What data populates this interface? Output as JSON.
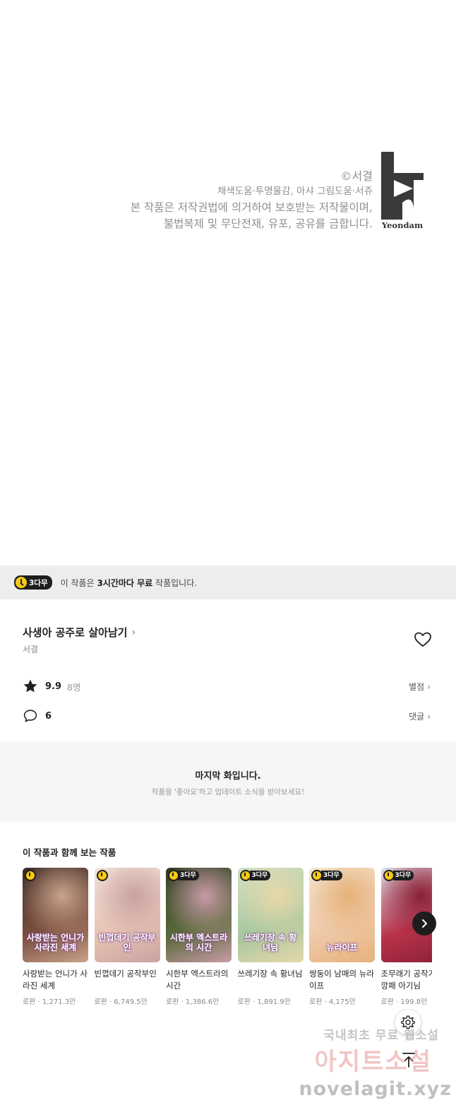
{
  "copyright": {
    "line1": "©서결",
    "line2": "채색도움·투명물감, 아샤 그림도움·서쥬",
    "line3": "본 작품은 저작권법에 의거하여 보호받는 저작물이며,",
    "line4": "불법복제 및 무단전재, 유포, 공유를 금합니다.",
    "logo_text": "Yeondam"
  },
  "free_banner": {
    "badge": "3다무",
    "text_pre": "이 작품은 ",
    "text_bold": "3시간마다 무료",
    "text_post": " 작품입니다."
  },
  "work": {
    "title": "사생아 공주로 살아남기",
    "title_chevron": "›",
    "author": "서결",
    "rating": "9.9",
    "rating_count": "8명",
    "comment_count": "6",
    "rate_link": "별점",
    "comment_link": "댓글",
    "link_chevron": "›"
  },
  "last_episode": {
    "title": "마지막 화입니다.",
    "subtitle": "작품을 '좋아요'하고 업데이트 소식을 받아보세요!"
  },
  "recommendations": {
    "heading": "이 작품과 함께 보는 작품",
    "items": [
      {
        "name": "사랑받는 언니가 사라진 세계",
        "meta": "로판 · 1,271.3만",
        "thumb_title": "사랑받는 언니가 사라진 세계",
        "badge": "",
        "colors": [
          "#3b2a26",
          "#7c4f3e",
          "#c9a38b"
        ]
      },
      {
        "name": "빈껍데기 공작부인",
        "meta": "로판 · 6,749.5만",
        "thumb_title": "빈껍데기 공작부인",
        "badge": "",
        "colors": [
          "#f2e6dc",
          "#e6c3b4",
          "#caa1a0"
        ]
      },
      {
        "name": "시한부 엑스트라의 시간",
        "meta": "로판 · 1,386.6만",
        "thumb_title": "시한부 엑스트라의 시간",
        "badge": "3다무",
        "colors": [
          "#2f3a22",
          "#5b6b3a",
          "#c99aa8"
        ]
      },
      {
        "name": "쓰레기장 속 황녀님",
        "meta": "로판 · 1,891.9만",
        "thumb_title": "쓰레기장 속 황녀님",
        "badge": "3다무",
        "colors": [
          "#cfe0c4",
          "#a9c7a0",
          "#e6d8a8"
        ]
      },
      {
        "name": "쌍둥이 남매의 뉴라이프",
        "meta": "로판 · 4,175만",
        "thumb_title": "뉴라이프",
        "badge": "3다무",
        "colors": [
          "#f3e7cf",
          "#efc9a8",
          "#e6b17a"
        ]
      },
      {
        "name": "조무래기 공작가의 깡패 아기님",
        "meta": "로판 · 199.8만",
        "thumb_title": "",
        "badge": "3다무",
        "colors": [
          "#d9dde6",
          "#b8324a",
          "#8a2136"
        ]
      }
    ]
  },
  "watermark": {
    "line1": "국내최초 무료 웹소설",
    "line2": "아지트소설",
    "line3": "novelagit.xyz"
  }
}
